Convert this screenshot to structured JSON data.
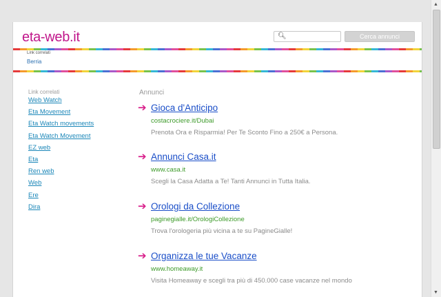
{
  "header": {
    "site_title": "eta-web.it",
    "search": {
      "placeholder": "",
      "button_label": "Cerca annunci"
    },
    "related": {
      "title": "Link correlati",
      "link": "Berria"
    }
  },
  "sidebar": {
    "title": "Link correlati",
    "links": [
      "Web Watch",
      "Eta Movement",
      "Eta Watch movements",
      "Eta Watch Movement",
      "EZ web",
      "Eta",
      "Ren web",
      "Web",
      "Ere",
      "Dira"
    ]
  },
  "ads": {
    "title": "Annunci",
    "items": [
      {
        "headline": "Gioca d'Anticipo",
        "url": "costacrociere.it/Dubai",
        "description": "Prenota Ora e Risparmia! Per Te Sconto Fino a 250€ a Persona."
      },
      {
        "headline": "Annunci Casa.it",
        "url": "www.casa.it",
        "description": "Scegli la Casa Adatta a Te! Tanti Annunci in Tutta Italia."
      },
      {
        "headline": "Orologi da Collezione",
        "url": "paginegialle.it/OrologiCollezione",
        "description": "Trova l'orologeria più vicina a te su PagineGialle!"
      },
      {
        "headline": "Organizza le tue Vacanze",
        "url": "www.homeaway.it",
        "description": "Visita Homeaway e scegli tra più di 450.000 case vacanze nel mondo"
      }
    ]
  },
  "colors": {
    "title": "#c0158a",
    "link": "#1a86b8",
    "ad_headline": "#1a4ec8",
    "ad_url": "#3d9a2a",
    "arrow": "#d81e8a"
  }
}
